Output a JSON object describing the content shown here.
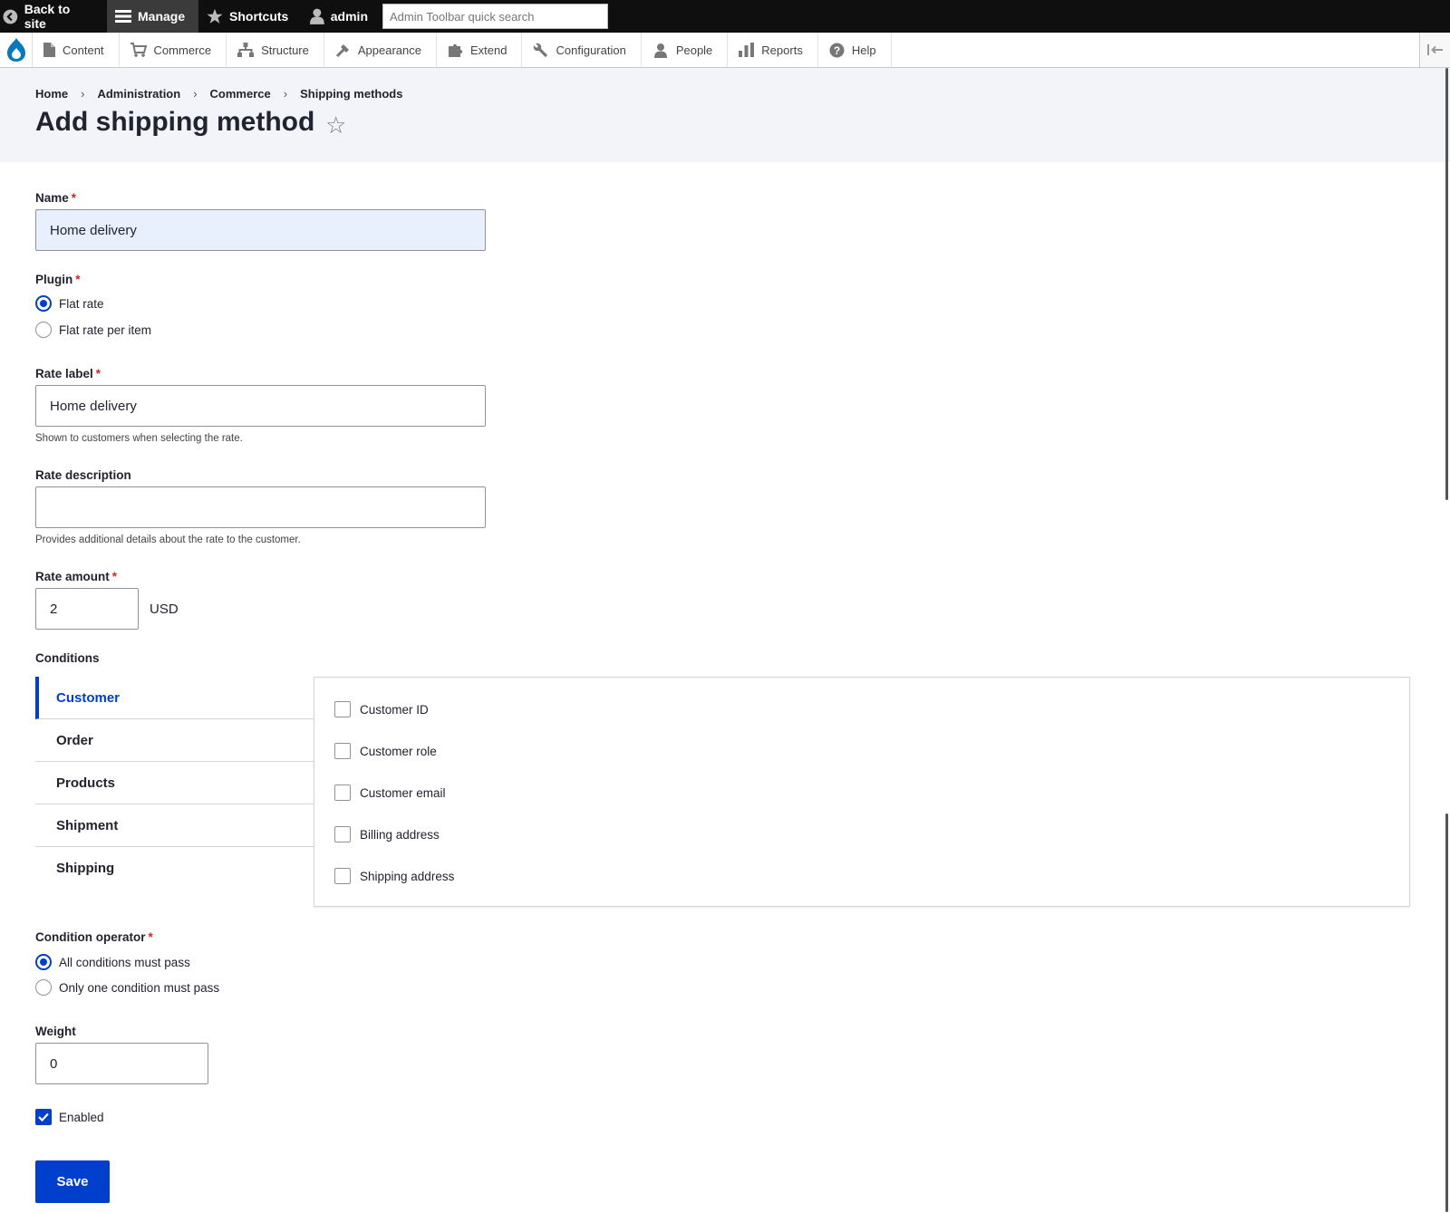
{
  "toolbar": {
    "back_label": "Back to site",
    "manage_label": "Manage",
    "shortcuts_label": "Shortcuts",
    "user_label": "admin",
    "search_placeholder": "Admin Toolbar quick search"
  },
  "tray": {
    "items": [
      {
        "label": "Content",
        "icon": "file-icon"
      },
      {
        "label": "Commerce",
        "icon": "cart-icon"
      },
      {
        "label": "Structure",
        "icon": "sitemap-icon"
      },
      {
        "label": "Appearance",
        "icon": "brush-icon"
      },
      {
        "label": "Extend",
        "icon": "puzzle-icon"
      },
      {
        "label": "Configuration",
        "icon": "wrench-icon"
      },
      {
        "label": "People",
        "icon": "people-icon"
      },
      {
        "label": "Reports",
        "icon": "bar-chart-icon"
      },
      {
        "label": "Help",
        "icon": "help-icon"
      }
    ]
  },
  "breadcrumb": [
    "Home",
    "Administration",
    "Commerce",
    "Shipping methods"
  ],
  "page_title": "Add shipping method",
  "form": {
    "name": {
      "label": "Name",
      "value": "Home delivery"
    },
    "plugin": {
      "label": "Plugin",
      "options": [
        "Flat rate",
        "Flat rate per item"
      ],
      "selected": "Flat rate"
    },
    "rate_label": {
      "label": "Rate label",
      "value": "Home delivery",
      "description": "Shown to customers when selecting the rate."
    },
    "rate_description": {
      "label": "Rate description",
      "value": "",
      "description": "Provides additional details about the rate to the customer."
    },
    "rate_amount": {
      "label": "Rate amount",
      "value": "2",
      "currency": "USD"
    },
    "conditions": {
      "label": "Conditions",
      "tabs": [
        "Customer",
        "Order",
        "Products",
        "Shipment",
        "Shipping"
      ],
      "active_tab": "Customer",
      "checkboxes": [
        "Customer ID",
        "Customer role",
        "Customer email",
        "Billing address",
        "Shipping address"
      ]
    },
    "condition_operator": {
      "label": "Condition operator",
      "options": [
        "All conditions must pass",
        "Only one condition must pass"
      ],
      "selected": "All conditions must pass"
    },
    "weight": {
      "label": "Weight",
      "value": "0"
    },
    "enabled": {
      "label": "Enabled",
      "checked": true
    },
    "save_label": "Save"
  },
  "colors": {
    "accent": "#003ecc",
    "required": "#d72222",
    "header_bg": "#f3f4f9",
    "toolbar_bg": "#0f0f0f"
  }
}
